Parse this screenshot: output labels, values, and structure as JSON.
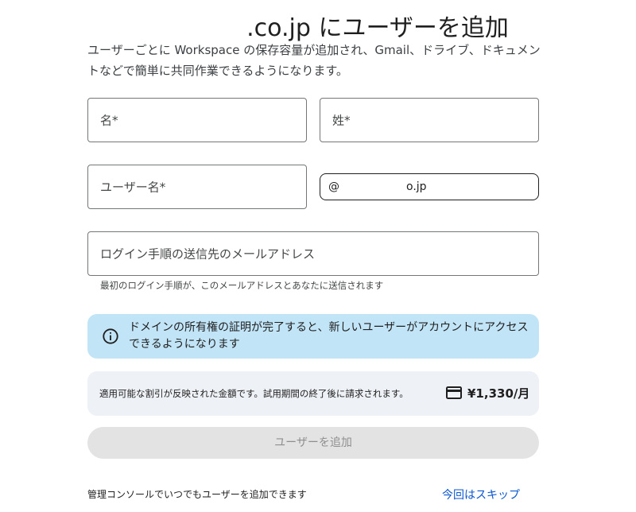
{
  "header": {
    "title": ".co.jp にユーザーを追加",
    "description": "ユーザーごとに Workspace の保存容量が追加され、Gmail、ドライブ、ドキュメントなどで簡単に共同作業できるようになります。"
  },
  "form": {
    "first_name_placeholder": "名*",
    "last_name_placeholder": "姓*",
    "username_placeholder": "ユーザー名*",
    "domain_at": "@",
    "domain_suffix": "o.jp",
    "recovery_email_placeholder": "ログイン手順の送信先のメールアドレス",
    "recovery_email_helper": "最初のログイン手順が、このメールアドレスとあなたに送信されます"
  },
  "info_banner": {
    "icon": "info-icon",
    "text": "ドメインの所有権の証明が完了すると、新しいユーザーがアカウントにアクセスできるようになります"
  },
  "pricing": {
    "text": "適用可能な割引が反映された金額です。試用期間の終了後に請求されます。",
    "icon": "credit-card-icon",
    "amount": "¥1,330/月"
  },
  "actions": {
    "add_user_label": "ユーザーを追加",
    "footer_note": "管理コンソールでいつでもユーザーを追加できます",
    "skip_label": "今回はスキップ"
  },
  "colors": {
    "info_background": "#c2e4f7",
    "price_background": "#eef1f5",
    "link": "#0b57d0",
    "disabled_button": "#e3e3e3"
  }
}
